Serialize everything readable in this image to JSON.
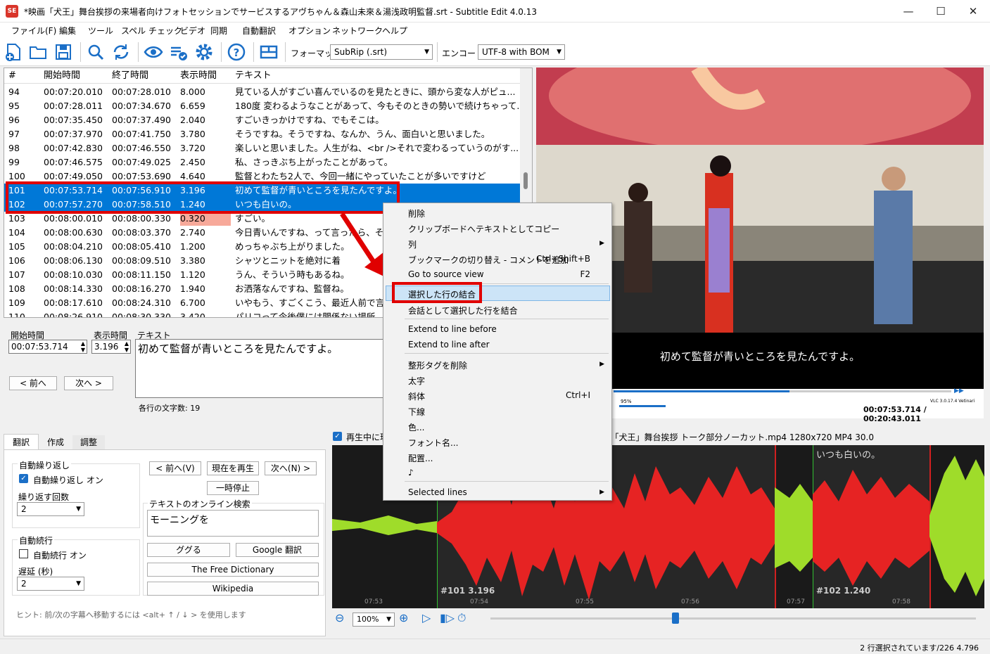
{
  "window": {
    "title": "*映画「犬王」舞台挨拶の来場者向けフォトセッションでサービスするアヴちゃん＆森山未來＆湯浅政明監督.srt - Subtitle Edit 4.0.13",
    "app_icon": "SE"
  },
  "menu": [
    "ファイル(F)",
    "編集",
    "ツール",
    "スペル チェック",
    "ビデオ",
    "同期",
    "自動翻訳",
    "オプション",
    "ネットワーク",
    "ヘルプ"
  ],
  "toolbar": {
    "format_label": "フォーマット",
    "format_value": "SubRip (.srt)",
    "encoding_label": "エンコード",
    "encoding_value": "UTF-8 with BOM"
  },
  "grid": {
    "headers": [
      "#",
      "開始時間",
      "終了時間",
      "表示時間",
      "テキスト"
    ],
    "rows": [
      {
        "n": "94",
        "start": "00:07:20.010",
        "end": "00:07:28.010",
        "dur": "8.000",
        "text": "見ている人がすごい喜んでいるのを見たときに、頭から変な人がピュ..."
      },
      {
        "n": "95",
        "start": "00:07:28.011",
        "end": "00:07:34.670",
        "dur": "6.659",
        "text": "180度 変わるようなことがあって、今もそのときの勢いで続けちゃって..."
      },
      {
        "n": "96",
        "start": "00:07:35.450",
        "end": "00:07:37.490",
        "dur": "2.040",
        "text": "すごいきっかけですね、でもそこは。"
      },
      {
        "n": "97",
        "start": "00:07:37.970",
        "end": "00:07:41.750",
        "dur": "3.780",
        "text": "そうですね。そうですね、なんか、うん、面白いと思いました。"
      },
      {
        "n": "98",
        "start": "00:07:42.830",
        "end": "00:07:46.550",
        "dur": "3.720",
        "text": "楽しいと思いました。人生がね、<br />それで変わるっていうのがす..."
      },
      {
        "n": "99",
        "start": "00:07:46.575",
        "end": "00:07:49.025",
        "dur": "2.450",
        "text": "私、さっきぶち上がったことがあって。"
      },
      {
        "n": "100",
        "start": "00:07:49.050",
        "end": "00:07:53.690",
        "dur": "4.640",
        "text": "監督とわたち2人で、今回一緒にやっていたことが多いですけど"
      },
      {
        "n": "101",
        "start": "00:07:53.714",
        "end": "00:07:56.910",
        "dur": "3.196",
        "text": "初めて監督が青いところを見たんですよ。"
      },
      {
        "n": "102",
        "start": "00:07:57.270",
        "end": "00:07:58.510",
        "dur": "1.240",
        "text": "いつも白いの。"
      },
      {
        "n": "103",
        "start": "00:08:00.010",
        "end": "00:08:00.330",
        "dur": "0.320",
        "text": "すごい。"
      },
      {
        "n": "104",
        "start": "00:08:00.630",
        "end": "00:08:03.370",
        "dur": "2.740",
        "text": "今日青いんですね、って言ったら、そう"
      },
      {
        "n": "105",
        "start": "00:08:04.210",
        "end": "00:08:05.410",
        "dur": "1.200",
        "text": "めっちゃぶち上がりました。"
      },
      {
        "n": "106",
        "start": "00:08:06.130",
        "end": "00:08:09.510",
        "dur": "3.380",
        "text": "シャツとニットを絶対に着"
      },
      {
        "n": "107",
        "start": "00:08:10.030",
        "end": "00:08:11.150",
        "dur": "1.120",
        "text": "うん、そういう時もあるね。"
      },
      {
        "n": "108",
        "start": "00:08:14.330",
        "end": "00:08:16.270",
        "dur": "1.940",
        "text": "お洒落なんですね、監督ね。"
      },
      {
        "n": "109",
        "start": "00:08:17.610",
        "end": "00:08:24.310",
        "dur": "6.700",
        "text": "いやもう、すごくこう、最近人前で言う"
      },
      {
        "n": "110",
        "start": "00:08:26.910",
        "end": "00:08:30.330",
        "dur": "3.420",
        "text": "パリコって今後僕には関係ない場所"
      }
    ]
  },
  "editor": {
    "start_label": "開始時間",
    "start_value": "00:07:53.714",
    "dur_label": "表示時間",
    "dur_value": "3.196",
    "text_label": "テキスト",
    "text_value": "初めて監督が青いところを見たんですよ。",
    "prev": "< 前へ",
    "next": "次へ >",
    "charcount": "各行の文字数: 19"
  },
  "video": {
    "subtitle": "初めて監督が青いところを見たんですよ。",
    "vlc": "VLC 3.0.17.4 Vetinari",
    "volume": "95%",
    "time": "00:07:53.714 / 00:20:43.011"
  },
  "tabs": {
    "items": [
      "翻訳",
      "作成",
      "調整"
    ],
    "autorepeat_group": "自動繰り返し",
    "autorepeat_on": "自動繰り返し オン",
    "repeat_count_label": "繰り返す回数",
    "repeat_count": "2",
    "autocontinue_group": "自動続行",
    "autocontinue_on": "自動続行 オン",
    "delay_label": "遅延 (秒)",
    "delay": "2",
    "prev": "< 前へ(V)",
    "play": "現在を再生",
    "next": "次へ(N) >",
    "pause": "一時停止",
    "search_label": "テキストのオンライン検索",
    "search_text": "モーニングを",
    "google": "ググる",
    "gtranslate": "Google 翻訳",
    "freedict": "The Free Dictionary",
    "wiki": "Wikipedia",
    "hint": "ヒント: 前/次の字幕へ移動するには <alt+ ↑ / ↓ > を使用します"
  },
  "wave": {
    "info": "再生中に現在字幕を選択    ちゃん＆森山未來＆湯浅政明監督による映画「犬王」舞台挨拶 トーク部分ノーカット.mp4 1280x720 MP4 30.0",
    "sub101": "#101  3.196",
    "sub102": "#102  1.240",
    "subtext102": "いつも白いの。",
    "ticks": [
      "07:53",
      "07:54",
      "07:55",
      "07:56",
      "07:57",
      "07:58"
    ],
    "zoom": "100%"
  },
  "ctx": {
    "items": [
      {
        "label": "削除",
        "sc": "",
        "sub": false
      },
      {
        "label": "クリップボードへテキストとしてコピー",
        "sc": "",
        "sub": false
      },
      {
        "label": "列",
        "sc": "",
        "sub": true
      },
      {
        "label": "ブックマークの切り替え - コメントを追加",
        "sc": "Ctrl+Shift+B",
        "sub": false
      },
      {
        "label": "Go to source view",
        "sc": "F2",
        "sub": false
      },
      {
        "label": "選択した行の結合",
        "sc": "",
        "sub": false
      },
      {
        "label": "会話として選択した行を結合",
        "sc": "",
        "sub": false
      },
      {
        "label": "Extend to line before",
        "sc": "",
        "sub": false
      },
      {
        "label": "Extend to line after",
        "sc": "",
        "sub": false
      },
      {
        "label": "整形タグを削除",
        "sc": "",
        "sub": true
      },
      {
        "label": "太字",
        "sc": "",
        "sub": false
      },
      {
        "label": "斜体",
        "sc": "Ctrl+I",
        "sub": false
      },
      {
        "label": "下線",
        "sc": "",
        "sub": false
      },
      {
        "label": "色...",
        "sc": "",
        "sub": false
      },
      {
        "label": "フォント名...",
        "sc": "",
        "sub": false
      },
      {
        "label": "配置...",
        "sc": "",
        "sub": false
      },
      {
        "label": "♪",
        "sc": "",
        "sub": false
      },
      {
        "label": "Selected lines",
        "sc": "",
        "sub": true
      }
    ]
  },
  "status": "2 行選択されています/226  4.796"
}
